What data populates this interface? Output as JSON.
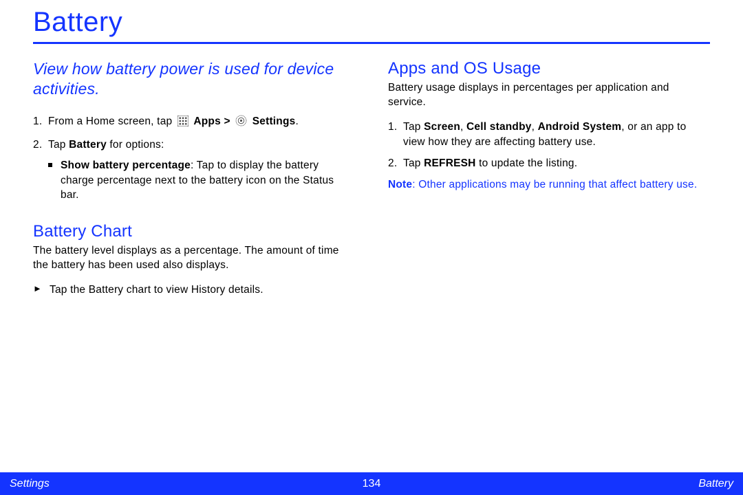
{
  "title": "Battery",
  "leftColumn": {
    "intro": "View how battery power is used for device activities.",
    "steps": {
      "step1": {
        "num": "1.",
        "text_a": "From a Home screen, tap ",
        "apps_label": "Apps",
        "gt": " > ",
        "settings_label": "Settings",
        "text_b": "."
      },
      "step2": {
        "num": "2.",
        "text_a": "Tap ",
        "battery_label": "Battery",
        "text_b": " for options:"
      },
      "bullet1": {
        "label": "Show battery percentage",
        "text": ": Tap to display the battery charge percentage next to the battery icon on the Status bar."
      }
    },
    "chartHeading": "Battery Chart",
    "chartBody": "The battery level displays as a percentage. The amount of time the battery has been used also displays.",
    "chartArrow": "Tap the Battery chart to view History details."
  },
  "rightColumn": {
    "heading": "Apps and OS Usage",
    "body": "Battery usage displays in percentages per application and service.",
    "steps": {
      "step1": {
        "num": "1.",
        "text_a": "Tap ",
        "screen": "Screen",
        "c1": ", ",
        "cell": "Cell standby",
        "c2": ", ",
        "android": "Android System",
        "text_b": ", or an app to view how they are affecting battery use."
      },
      "step2": {
        "num": "2.",
        "text_a": "Tap ",
        "refresh": "REFRESH",
        "text_b": " to update the listing."
      }
    },
    "noteLabel": "Note",
    "noteText": ": Other applications may be running that affect battery use."
  },
  "footer": {
    "left": "Settings",
    "center": "134",
    "right": "Battery"
  }
}
